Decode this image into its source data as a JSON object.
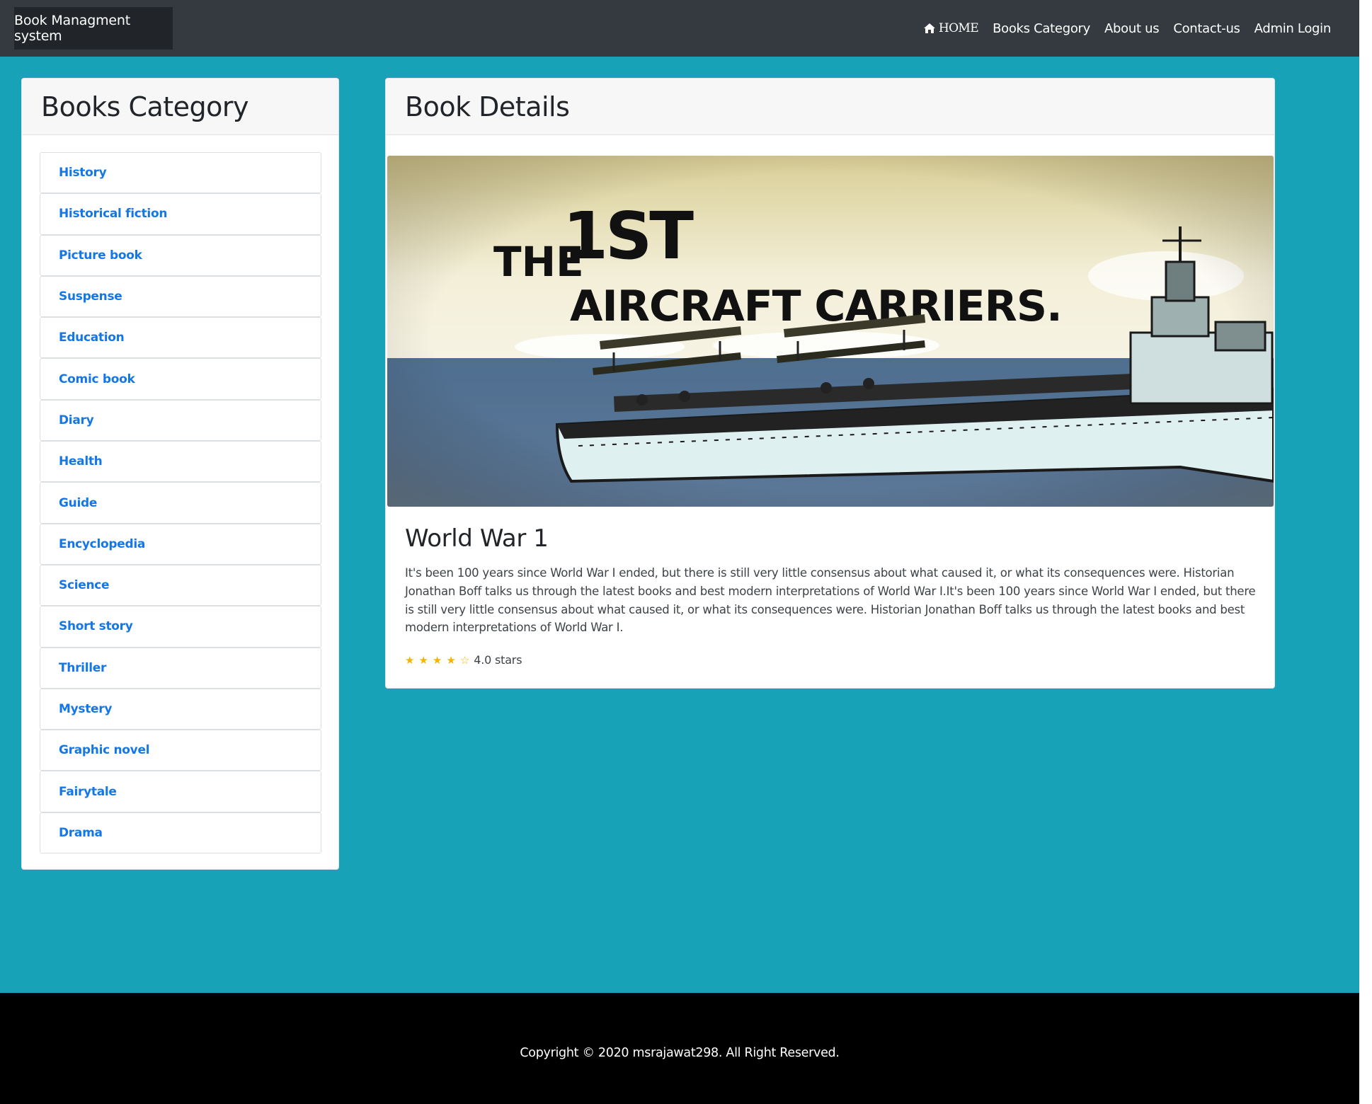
{
  "navbar": {
    "brand": "Book Managment system",
    "links": [
      {
        "label": "HOME",
        "icon": "home-icon"
      },
      {
        "label": "Books Category"
      },
      {
        "label": "About us"
      },
      {
        "label": "Contact-us"
      },
      {
        "label": "Admin Login"
      }
    ]
  },
  "sidebar": {
    "title": "Books Category",
    "categories": [
      "History",
      "Historical fiction",
      "Picture book",
      "Suspense",
      "Education",
      "Comic book",
      "Diary",
      "Health",
      "Guide",
      "Encyclopedia",
      "Science",
      "Short story",
      "Thriller",
      "Mystery",
      "Graphic novel",
      "Fairytale",
      "Drama"
    ]
  },
  "detail": {
    "header": "Book Details",
    "cover": {
      "headline_small": "THE",
      "headline_big": "1ST",
      "headline_line2": "AIRCRAFT CARRIERS."
    },
    "title": "World War 1",
    "description": "It's been 100 years since World War I ended, but there is still very little consensus about what caused it, or what its consequences were. Historian Jonathan Boff talks us through the latest books and best modern interpretations of World War I.It's been 100 years since World War I ended, but there is still very little consensus about what caused it, or what its consequences were. Historian Jonathan Boff talks us through the latest books and best modern interpretations of World War I.",
    "rating": {
      "value": 4,
      "max": 5,
      "label": "4.0 stars",
      "star_color": "#f5b400"
    }
  },
  "footer": {
    "text": "Copyright © 2020 msrajawat298. All Right Reserved."
  },
  "colors": {
    "page_bg": "#17a2b8",
    "navbar_bg": "#343a40",
    "brand_bg": "#212529",
    "link_blue": "#1577e6",
    "footer_bg": "#000000"
  }
}
